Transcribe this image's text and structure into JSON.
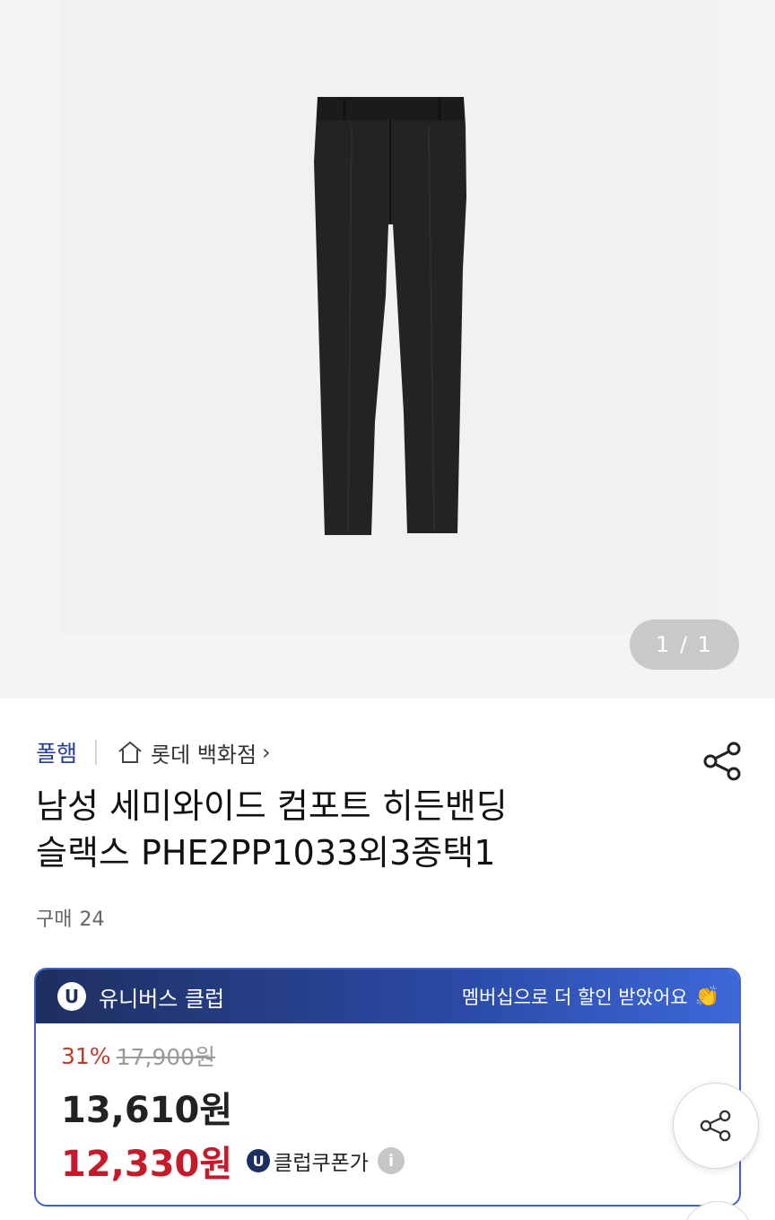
{
  "gallery": {
    "page_indicator": "1 / 1"
  },
  "product": {
    "brand": "폴햄",
    "store": "롯데 백화점",
    "store_chevron": "›",
    "title_line1": "남성 세미와이드 컴포트 히든밴딩",
    "title_line2": "슬랙스 PHE2PP1033외3종택1",
    "purchase_label": "구매",
    "purchase_count": "24"
  },
  "club": {
    "badge": "U",
    "name": "유니버스 클럽",
    "message": "멤버십으로 더 할인 받았어요",
    "emoji": "👏",
    "discount_rate": "31%",
    "original_price": "17,900원",
    "sale_price": "13,610원",
    "coupon_price": "12,330원",
    "coupon_label": "클럽쿠폰가",
    "info_glyph": "i"
  },
  "colors": {
    "brand_blue": "#24408e",
    "club_navy": "#1e2f60",
    "discount_red": "#c0392b",
    "coupon_red": "#c61a2a"
  },
  "icons": {
    "store": "home-icon",
    "share": "share-icon",
    "info": "info-icon"
  }
}
